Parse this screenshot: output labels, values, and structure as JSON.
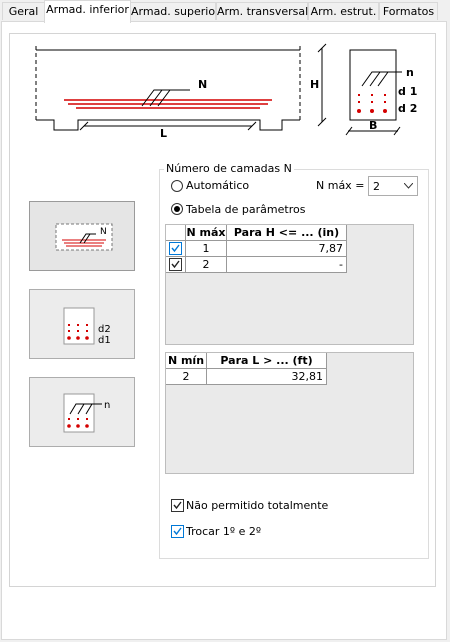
{
  "tabs": [
    {
      "label": "Geral",
      "active": false
    },
    {
      "label": "Armad. inferior",
      "active": true
    },
    {
      "label": "Armad. superior",
      "active": false
    },
    {
      "label": "Arm. transversal",
      "active": false
    },
    {
      "label": "Arm. estrut.",
      "active": false
    },
    {
      "label": "Formatos",
      "active": false
    }
  ],
  "diagram": {
    "label_n": "N",
    "label_h": "H",
    "label_l": "L",
    "label_b": "B",
    "label_n2": "n",
    "label_d1": "d 1",
    "label_d2": "d 2"
  },
  "thumbs": [
    {
      "label": "N"
    },
    {
      "label_top": "d2",
      "label_bottom": "d1"
    },
    {
      "label": "n"
    }
  ],
  "group": {
    "title": "Número de camadas N",
    "auto_label": "Automático",
    "table_label": "Tabela de parâmetros",
    "mode": "table",
    "nmax_label": "N máx =",
    "nmax_value": "2"
  },
  "table_h": {
    "headers": [
      "N máx",
      "Para H <= ... (in)"
    ],
    "rows": [
      {
        "checked": true,
        "nmax": "1",
        "value": "7,87"
      },
      {
        "checked": true,
        "nmax": "2",
        "value": "-"
      }
    ]
  },
  "table_l": {
    "headers": [
      "N mín",
      "Para L > ... (ft)"
    ],
    "rows": [
      {
        "nmin": "2",
        "value": "32,81"
      }
    ]
  },
  "options": {
    "nao_permitido_label": "Não permitido totalmente",
    "nao_permitido_checked": true,
    "trocar_label": "Trocar 1º e 2º",
    "trocar_checked": true
  },
  "colors": {
    "bar_red": "#d40000",
    "check_blue": "#0078d7"
  }
}
